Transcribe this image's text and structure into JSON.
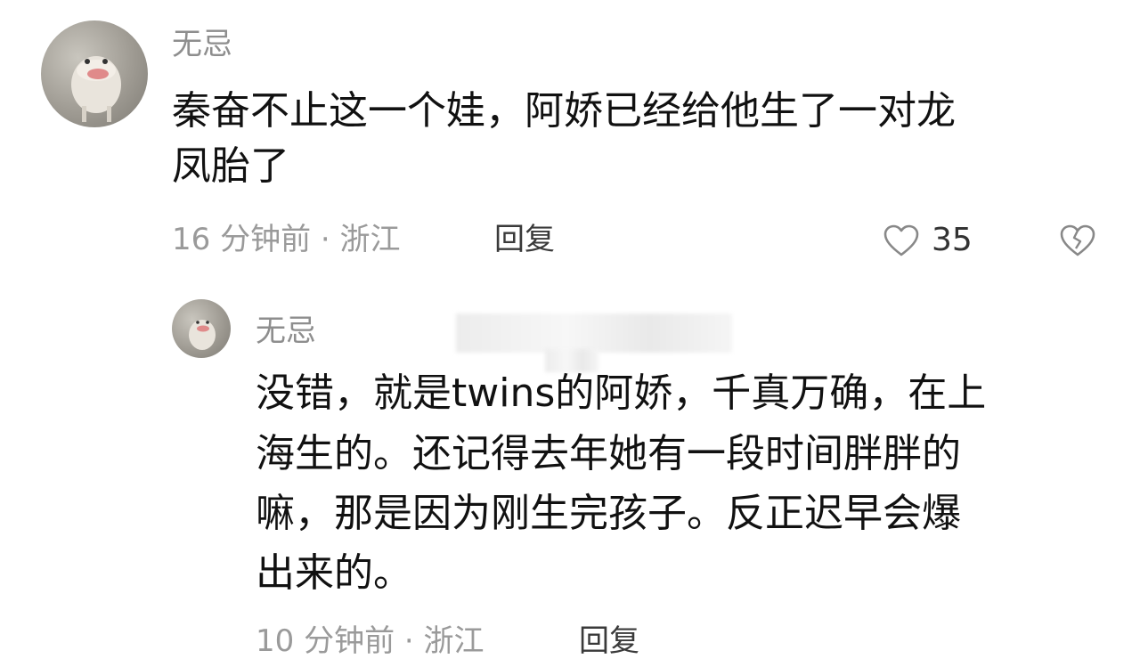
{
  "comment": {
    "username": "无忌",
    "text_line1": "秦奋不止这一个娃，阿娇已经给他生了一对龙",
    "text_line2": "凤胎了",
    "time": "16 分钟前",
    "separator": "·",
    "location": "浙江",
    "reply_label": "回复",
    "like_count": "35",
    "like_icon": "heart-outline-icon",
    "dislike_icon": "broken-heart-icon"
  },
  "reply": {
    "username": "无忌",
    "text_line1": "没错，就是twins的阿娇，千真万确，在上",
    "text_line2": "海生的。还记得去年她有一段时间胖胖的",
    "text_line3": "嘛，那是因为刚生完孩子。反正迟早会爆",
    "text_line4": "出来的。",
    "time": "10 分钟前",
    "separator": "·",
    "location": "浙江",
    "reply_label": "回复"
  },
  "colors": {
    "text": "#111111",
    "username": "#8e8e8e",
    "meta": "#9a9a9a",
    "icon": "#888888"
  }
}
